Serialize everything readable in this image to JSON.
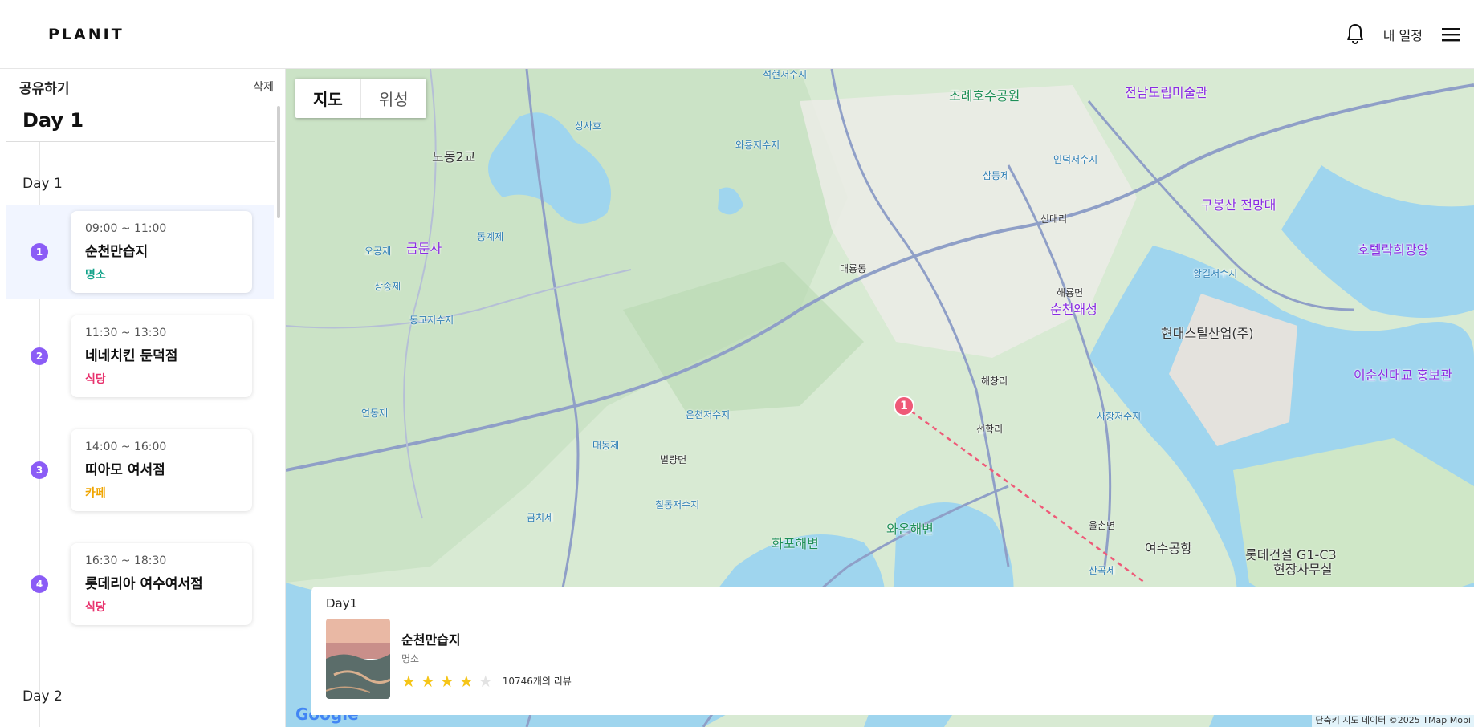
{
  "header": {
    "logo": "PLANIT",
    "my_schedule": "내 일정",
    "bell_icon": "bell-icon",
    "menu_icon": "menu-icon"
  },
  "sidebar": {
    "share_title": "공유하기",
    "delete_label": "삭제",
    "day_heading": "Day 1",
    "day1_label": "Day 1",
    "day2_label": "Day 2",
    "items": [
      {
        "num": "1",
        "time": "09:00 ~ 11:00",
        "name": "순천만습지",
        "category": "명소",
        "cat_color": "#14a38b"
      },
      {
        "num": "2",
        "time": "11:30 ~ 13:30",
        "name": "네네치킨 둔덕점",
        "category": "식당",
        "cat_color": "#e8336e"
      },
      {
        "num": "3",
        "time": "14:00 ~ 16:00",
        "name": "띠아모 여서점",
        "category": "카페",
        "cat_color": "#f0a500"
      },
      {
        "num": "4",
        "time": "16:30 ~ 18:30",
        "name": "롯데리아 여수여서점",
        "category": "식당",
        "cat_color": "#e8336e"
      }
    ]
  },
  "map": {
    "toggle_map": "지도",
    "toggle_satellite": "위성",
    "pin_label": "1",
    "attribution": "단축키   지도 데이터 ©2025 TMap Mobi",
    "google": "Google",
    "labels": {
      "l1": "조례호수공원",
      "l2": "전남도립미술관",
      "l3": "구봉산 전망대",
      "l4": "호텔락희광양",
      "l5": "순천왜성",
      "l6": "현대스틸산업(주)",
      "l7": "이순신대교 홍보관",
      "l8": "금둔사",
      "l9": "노동2교",
      "l10": "와온해변",
      "l11": "화포해변",
      "l12": "여수공항",
      "l13": "롯데건설 G1-C3",
      "l14": "현장사무실",
      "l15": "상사호",
      "l16": "해룡면",
      "l17": "선학리",
      "l18": "신대리",
      "l19": "별량면",
      "l20": "대룡동",
      "l21": "율촌면",
      "l22": "해창리",
      "l23": "연동제",
      "l24": "대동제",
      "l25": "금치제",
      "l26": "칠동저수지",
      "l27": "운천저수지",
      "l28": "상송제",
      "l29": "동교저수지",
      "l30": "오공제",
      "l31": "동계제",
      "l32": "사항저수지",
      "l33": "인덕저수지",
      "l34": "석현저수지",
      "l35": "와룡저수지",
      "l36": "삼동제",
      "l37": "황길저수지",
      "l38": "산곡제"
    }
  },
  "info_panel": {
    "day": "Day1",
    "name": "순천만습지",
    "category": "명소",
    "rating": 4,
    "max_rating": 5,
    "reviews": "10746개의 리뷰"
  },
  "colors": {
    "accent": "#8b5cf6",
    "pin": "#ef5a78",
    "star": "#f5c518"
  }
}
